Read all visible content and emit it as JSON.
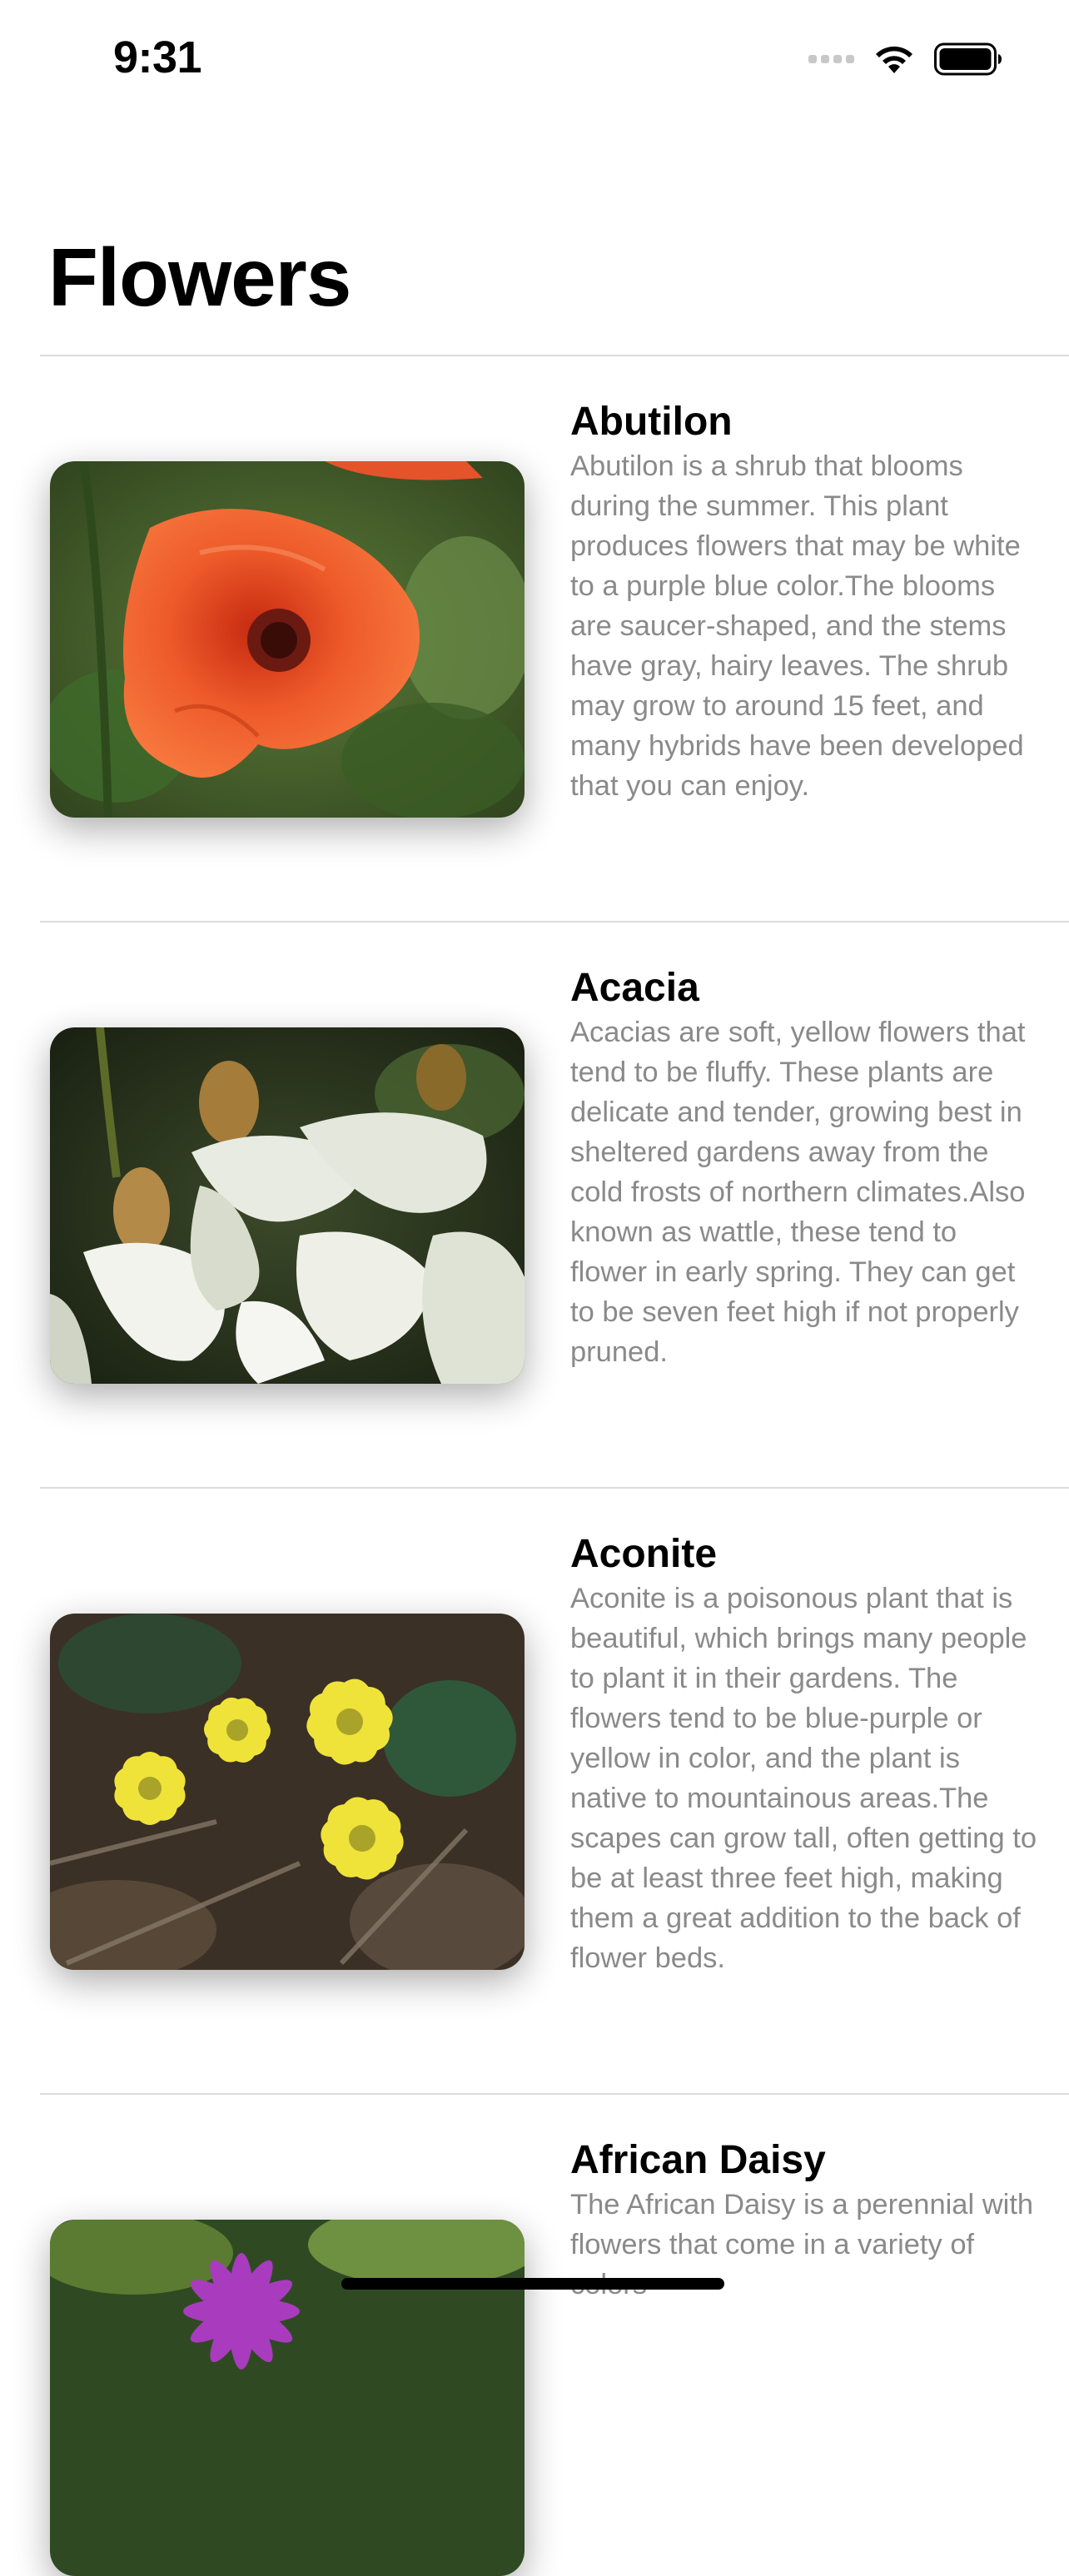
{
  "status_bar": {
    "time": "9:31"
  },
  "title": "Flowers",
  "flowers": [
    {
      "name": "Abutilon",
      "description": "Abutilon is a shrub that blooms during the summer. This plant produces flowers that may be white to a purple blue color.The blooms are saucer-shaped, and the stems have gray, hairy leaves. The shrub may grow to around 15 feet, and many hybrids have been developed that you can enjoy.",
      "image": "red-abutilon-flower-photo"
    },
    {
      "name": "Acacia",
      "description": "Acacias are soft, yellow flowers that tend to be fluffy. These plants are delicate and tender, growing best in sheltered gardens away from the cold frosts of northern climates.Also known as wattle, these tend to flower in early spring. They can get to be seven feet high if not properly pruned.",
      "image": "white-acacia-flower-photo"
    },
    {
      "name": "Aconite",
      "description": "Aconite is a poisonous plant that is beautiful, which brings many people to plant it in their gardens. The flowers tend to be blue-purple or yellow in color, and the plant is native to mountainous areas.The scapes can grow tall, often getting to be at least three feet high, making them a great addition to the back of flower beds.",
      "image": "yellow-aconite-flower-photo"
    },
    {
      "name": "African Daisy",
      "description": "The African Daisy is a perennial with flowers that come in a variety of colors",
      "image": "purple-african-daisy-photo"
    }
  ],
  "colors": {
    "description_text": "#8a8a8a",
    "separator": "#dcdcdc"
  }
}
